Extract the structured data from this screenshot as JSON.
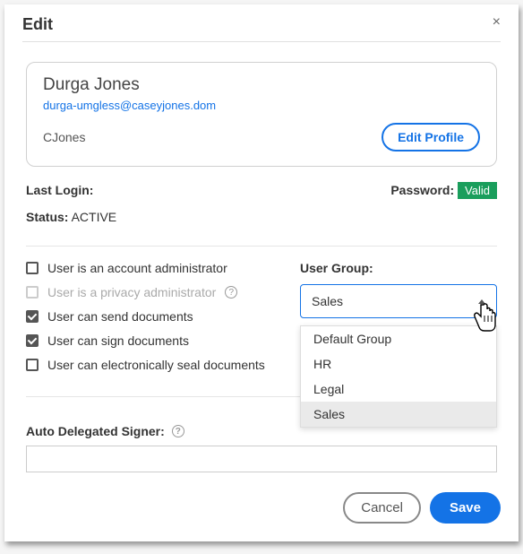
{
  "modal": {
    "title": "Edit",
    "close": "×"
  },
  "profile": {
    "name": "Durga Jones",
    "email": "durga-umgless@caseyjones.dom",
    "username": "CJones",
    "edit_button": "Edit Profile"
  },
  "login": {
    "label": "Last Login:",
    "value": ""
  },
  "password": {
    "label": "Password:",
    "badge": "Valid"
  },
  "status": {
    "label": "Status:",
    "value": "ACTIVE"
  },
  "perms": {
    "admin": "User is an account administrator",
    "privacy": "User is a privacy administrator",
    "send": "User can send documents",
    "sign": "User can sign documents",
    "seal": "User can electronically seal documents"
  },
  "group": {
    "label": "User Group:",
    "selected": "Sales",
    "options": [
      "Default Group",
      "HR",
      "Legal",
      "Sales"
    ]
  },
  "auto_delegate": {
    "label": "Auto Delegated Signer:",
    "value": ""
  },
  "footer": {
    "cancel": "Cancel",
    "save": "Save"
  }
}
